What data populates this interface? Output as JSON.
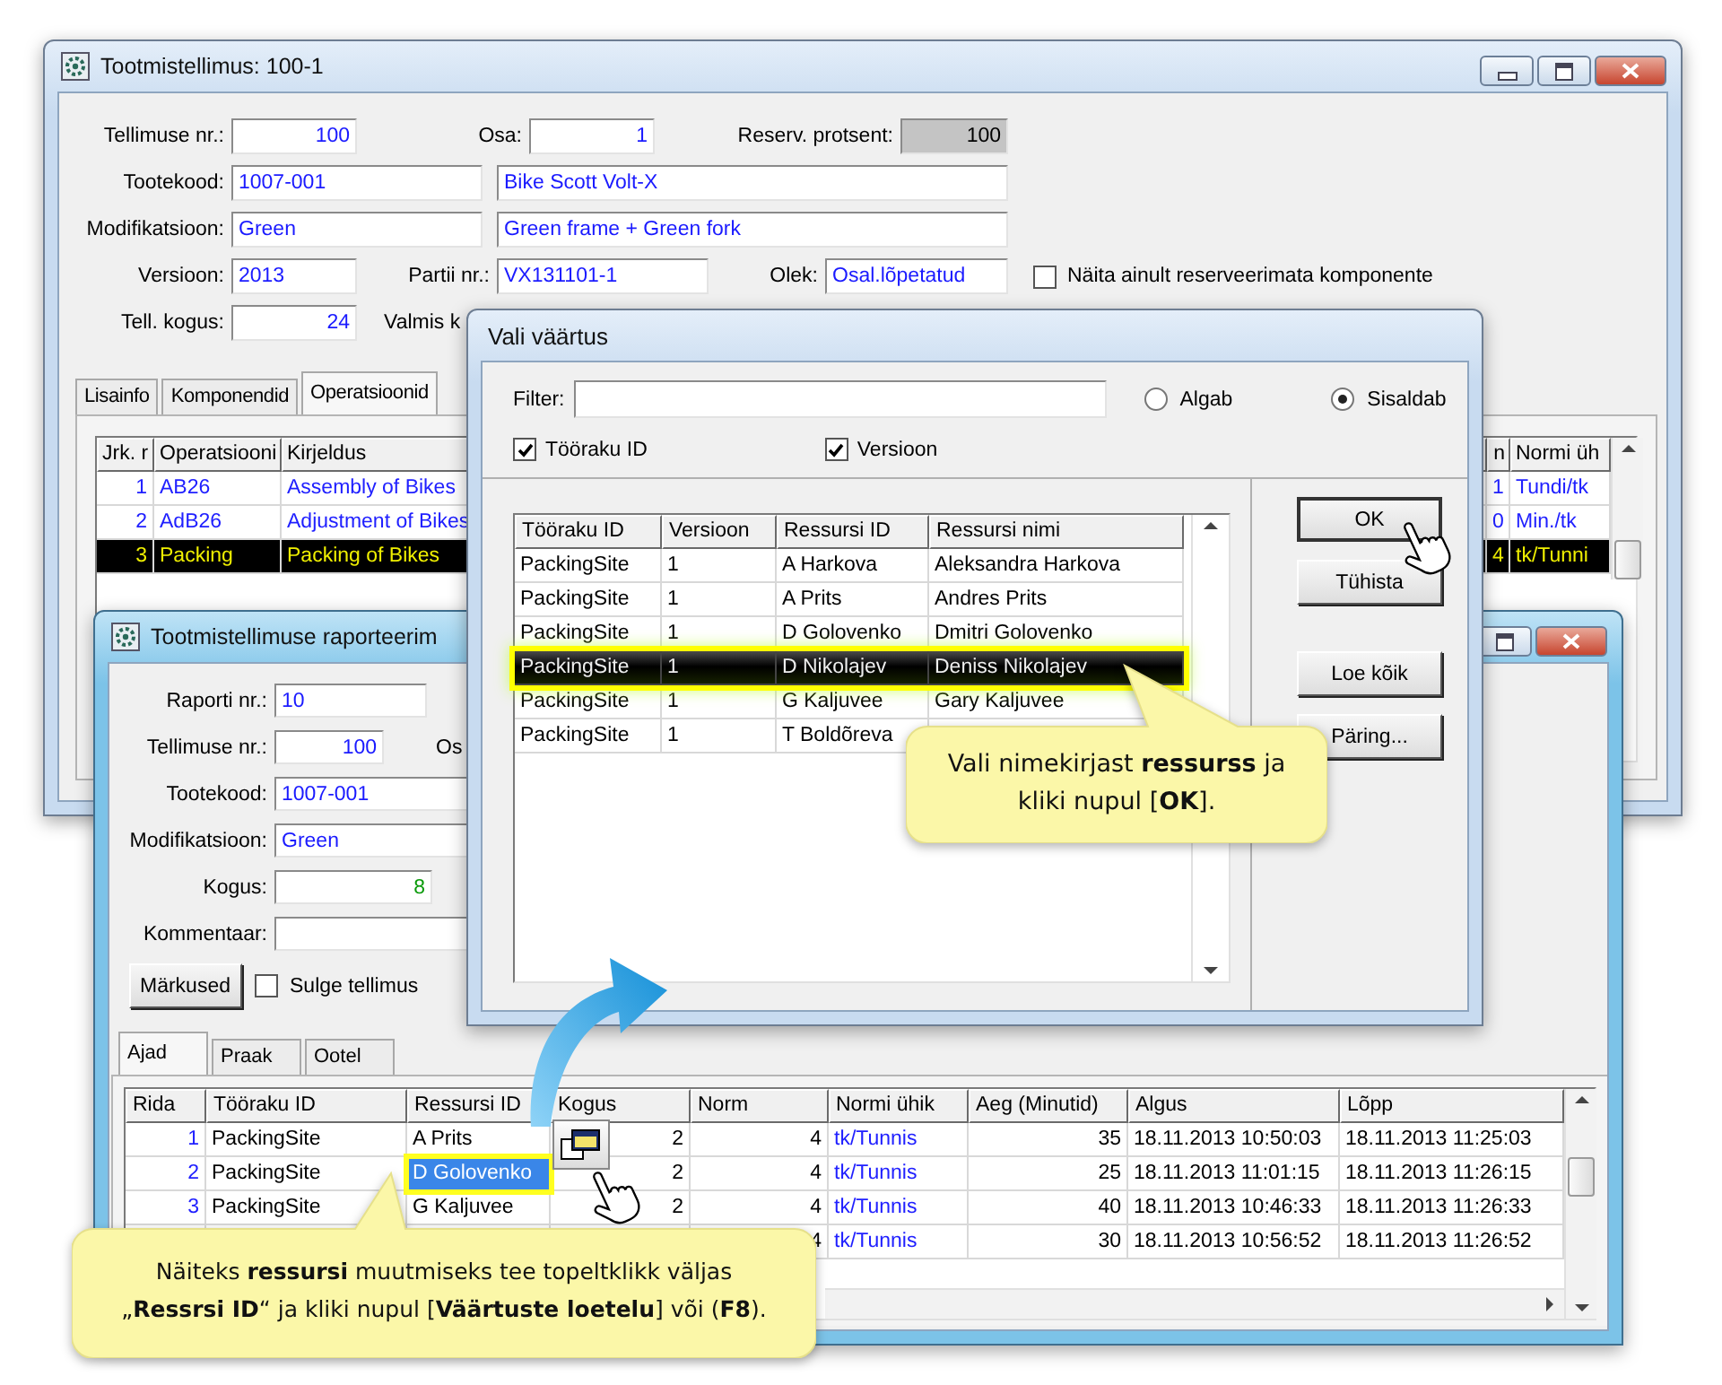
{
  "order_window": {
    "title": "Tootmistellimus: 100-1",
    "form_rows": [
      [
        {
          "kind": "number",
          "label": "Tellimuse nr.:",
          "value": "100"
        },
        {
          "kind": "number",
          "label": "Osa:",
          "value": "1"
        },
        {
          "kind": "readonly",
          "label": "Reserv. protsent:",
          "value": "100"
        }
      ],
      [
        {
          "kind": "text",
          "label": "Tootekood:",
          "value": "1007-001"
        },
        {
          "kind": "text",
          "value": "Bike Scott Volt-X"
        }
      ],
      [
        {
          "kind": "text",
          "label": "Modifikatsioon:",
          "value": "Green"
        },
        {
          "kind": "text",
          "value": "Green frame + Green fork"
        }
      ],
      [
        {
          "kind": "text",
          "label": "Versioon:",
          "value": "2013"
        },
        {
          "kind": "text",
          "label": "Partii nr.:",
          "value": "VX131101-1"
        },
        {
          "kind": "text",
          "label": "Olek:",
          "value": "Osal.lõpetatud"
        },
        {
          "kind": "checkbox",
          "label": "Näita ainult reserveerimata komponente",
          "checked": false
        }
      ],
      [
        {
          "kind": "number",
          "label": "Tell. kogus:",
          "value": "24"
        },
        {
          "kind": "caption",
          "label": "Valmis k"
        }
      ]
    ],
    "tabs": [
      {
        "label": "Lisainfo",
        "selected": false
      },
      {
        "label": "Komponendid",
        "selected": false
      },
      {
        "label": "Operatsioonid",
        "selected": true
      }
    ],
    "table": {
      "columns": [
        "Jrk. r",
        "Operatsiooni",
        "Kirjeldus",
        "n",
        "Normi üh"
      ],
      "rows": [
        {
          "selected": false,
          "cells": [
            "1",
            "AB26",
            "Assembly of Bikes",
            "1",
            "Tundi/tk"
          ]
        },
        {
          "selected": false,
          "cells": [
            "2",
            "AdB26",
            "Adjustment of Bikes",
            "0",
            "Min./tk"
          ]
        },
        {
          "selected": true,
          "cells": [
            "3",
            "Packing",
            "Packing of Bikes",
            "4",
            "tk/Tunni"
          ]
        }
      ]
    }
  },
  "report_window": {
    "title": "Tootmistellimuse raporteerim",
    "fields": [
      {
        "kind": "text",
        "label": "Raporti nr.:",
        "value": "10"
      },
      {
        "kind": "number",
        "label": "Tellimuse nr.:",
        "value": "100",
        "side_label": "Os"
      },
      {
        "kind": "text",
        "label": "Tootekood:",
        "value": "1007-001"
      },
      {
        "kind": "text",
        "label": "Modifikatsioon:",
        "value": "Green"
      },
      {
        "kind": "count",
        "label": "Kogus:",
        "value": "8"
      },
      {
        "kind": "text",
        "label": "Kommentaar:"
      }
    ],
    "notes_button": "Märkused",
    "close_order": {
      "label": "Sulge tellimus",
      "checked": false
    },
    "tabs": [
      {
        "label": "Ajad",
        "selected": true
      },
      {
        "label": "Praak",
        "selected": false
      },
      {
        "label": "Ootel",
        "selected": false
      }
    ],
    "table": {
      "columns": [
        "Rida",
        "Tööraku ID",
        "Ressursi ID",
        "Kogus",
        "Norm",
        "Normi ühik",
        "Aeg (Minutid)",
        "Algus",
        "Lõpp"
      ],
      "rows": [
        {
          "selected": false,
          "cells": [
            "1",
            "PackingSite",
            "A Prits",
            "2",
            "4",
            "tk/Tunnis",
            "35",
            "18.11.2013 10:50:03",
            "18.11.2013 11:25:03"
          ]
        },
        {
          "selected": true,
          "cells": [
            "2",
            "PackingSite",
            "D Golovenko",
            "2",
            "4",
            "tk/Tunnis",
            "25",
            "18.11.2013 11:01:15",
            "18.11.2013 11:26:15"
          ]
        },
        {
          "selected": false,
          "cells": [
            "3",
            "PackingSite",
            "G Kaljuvee",
            "2",
            "4",
            "tk/Tunnis",
            "40",
            "18.11.2013 10:46:33",
            "18.11.2013 11:26:33"
          ]
        },
        {
          "cells": [
            null,
            null,
            null,
            null,
            "4",
            "tk/Tunnis",
            "30",
            "18.11.2013 10:56:52",
            "18.11.2013 11:26:52"
          ]
        }
      ]
    }
  },
  "value_dialog": {
    "title": "Vali väärtus",
    "filter_label": "Filter:",
    "match_options": [
      {
        "label": "Algab",
        "selected": false
      },
      {
        "label": "Sisaldab",
        "selected": true
      }
    ],
    "checkboxes": [
      {
        "label": "Tööraku ID",
        "checked": true
      },
      {
        "label": "Versioon",
        "checked": true
      }
    ],
    "table": {
      "columns": [
        "Tööraku ID",
        "Versioon",
        "Ressursi ID",
        "Ressursi nimi"
      ],
      "rows": [
        {
          "selected": false,
          "cells": [
            "PackingSite",
            "1",
            "A Harkova",
            "Aleksandra Harkova"
          ]
        },
        {
          "selected": false,
          "cells": [
            "PackingSite",
            "1",
            "A Prits",
            "Andres Prits"
          ]
        },
        {
          "selected": false,
          "cells": [
            "PackingSite",
            "1",
            "D Golovenko",
            "Dmitri Golovenko"
          ]
        },
        {
          "selected": true,
          "cells": [
            "PackingSite",
            "1",
            "D Nikolajev",
            "Deniss Nikolajev"
          ]
        },
        {
          "selected": false,
          "cells": [
            "PackingSite",
            "1",
            "G Kaljuvee",
            "Gary Kaljuvee"
          ]
        },
        {
          "selected": false,
          "cells": [
            "PackingSite",
            "1",
            "T Boldõreva",
            null
          ]
        }
      ]
    },
    "buttons": [
      "OK",
      "Tühista",
      "Loe kõik",
      "Päring..."
    ]
  },
  "callouts": [
    {
      "text": "Vali nimekirjast **ressurss** ja kliki nupul [**OK**]."
    },
    {
      "text": "Näiteks **ressursi** muutmiseks tee topeltklikk väljas „**Ressrsi ID**“ ja kliki nupul [**Väärtuste loetelu**] või (**F8**)."
    }
  ]
}
